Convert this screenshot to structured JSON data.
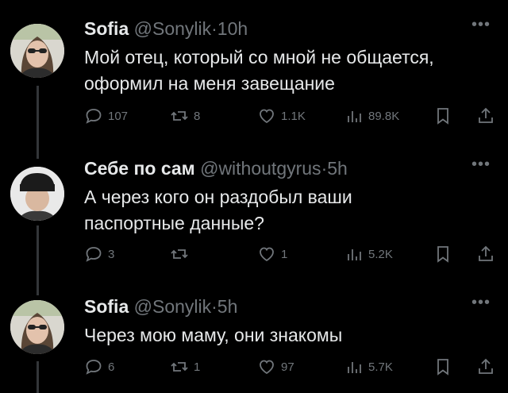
{
  "tweets": [
    {
      "name": "Sofia",
      "handle": "@Sonylik",
      "dot": "·",
      "time": "10h",
      "text_lines": [
        "Мой отец, который со мной не общается,",
        "оформил на меня завещание"
      ],
      "replies": "107",
      "reposts": "8",
      "likes": "1.1K",
      "views": "89.8K"
    },
    {
      "name": "Себе по сам",
      "handle": "@withoutgyrus",
      "dot": "·",
      "time": "5h",
      "text_lines": [
        "А через кого он раздобыл ваши",
        "паспортные данные?"
      ],
      "replies": "3",
      "reposts": "",
      "likes": "1",
      "views": "5.2K"
    },
    {
      "name": "Sofia",
      "handle": "@Sonylik",
      "dot": "·",
      "time": "5h",
      "text_lines": [
        "Через мою маму, они знакомы"
      ],
      "replies": "6",
      "reposts": "1",
      "likes": "97",
      "views": "5.7K"
    }
  ],
  "more_icon": "•••",
  "icons": [
    "reply-icon",
    "repost-icon",
    "like-icon",
    "views-icon",
    "bookmark-icon",
    "share-icon"
  ],
  "colors": {
    "background": "#000000",
    "text": "#e7e9ea",
    "muted": "#71767b",
    "thread_line": "#333639"
  }
}
